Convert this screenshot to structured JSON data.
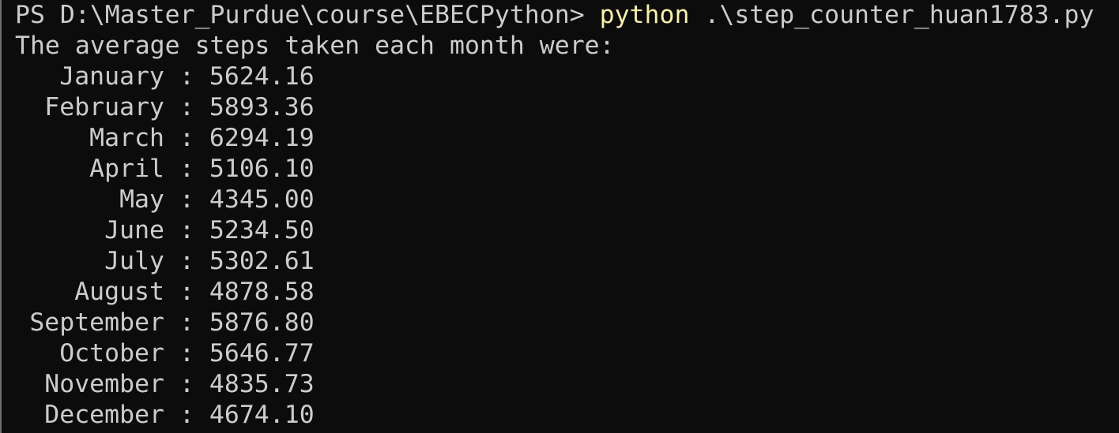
{
  "colors": {
    "background": "#0c0c0c",
    "text": "#cccccc",
    "command_highlight": "#f9f1a5"
  },
  "prompt": {
    "path": "PS D:\\Master_Purdue\\course\\EBECPython>",
    "command": "python",
    "argument": ".\\step_counter_huan1783.py"
  },
  "output": {
    "heading": "The average steps taken each month were:",
    "separator": ":",
    "rows": [
      {
        "month": "January",
        "value": "5624.16"
      },
      {
        "month": "February",
        "value": "5893.36"
      },
      {
        "month": "March",
        "value": "6294.19"
      },
      {
        "month": "April",
        "value": "5106.10"
      },
      {
        "month": "May",
        "value": "4345.00"
      },
      {
        "month": "June",
        "value": "5234.50"
      },
      {
        "month": "July",
        "value": "5302.61"
      },
      {
        "month": "August",
        "value": "4878.58"
      },
      {
        "month": "September",
        "value": "5876.80"
      },
      {
        "month": "October",
        "value": "5646.77"
      },
      {
        "month": "November",
        "value": "4835.73"
      },
      {
        "month": "December",
        "value": "4674.10"
      }
    ]
  }
}
